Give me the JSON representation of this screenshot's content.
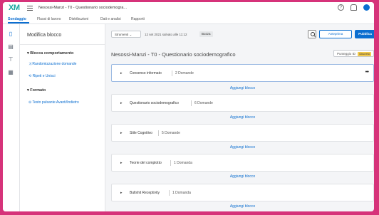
{
  "app": {
    "logo_main": "XM",
    "survey_title": "Nesossi-Manzi - T0 - Questionario sociodemogra...",
    "help_icon": "help-icon",
    "bell_icon": "bell-icon",
    "avatar_icon": "avatar-icon"
  },
  "nav": {
    "tabs": [
      "Sondaggio",
      "Flussi di lavoro",
      "Distribuzioni",
      "Dati e analisi",
      "Rapporti"
    ],
    "active": "Sondaggio"
  },
  "rail": {
    "icons": [
      "survey-icon",
      "look-and-feel-icon",
      "survey-flow-icon",
      "options-icon"
    ]
  },
  "panel": {
    "title": "Modifica blocco",
    "section1": "Blocca comportamento",
    "item1": "Randomizzazione domande",
    "item2": "Ripeti e Unisci",
    "section2": "Formato",
    "item3": "Testo pulsante Avanti/Indietro"
  },
  "toolbar": {
    "tools_label": "Strumenti",
    "saved_text": "12 set 2021 salvato alle 11:12",
    "status_badge": "Bozza",
    "preview_label": "Anteprima",
    "publish_label": "Pubblica"
  },
  "survey": {
    "heading": "Nesossi-Manzi - T0 - Questionario sociodemografico",
    "score_label": "Punteggio ID",
    "score_badge": "Discreto",
    "add_block_label": "Aggiungi blocco",
    "blocks": [
      {
        "name": "Consenso informato",
        "count": "2 Domande"
      },
      {
        "name": "Questionario sociodemografico",
        "count": "6 Domande"
      },
      {
        "name": "Stile Cognitivo",
        "count": "5 Domande"
      },
      {
        "name": "Teorie del complotto",
        "count": "1 Domanda"
      },
      {
        "name": "Bullshit Receptivity",
        "count": "1 Domanda"
      }
    ]
  }
}
